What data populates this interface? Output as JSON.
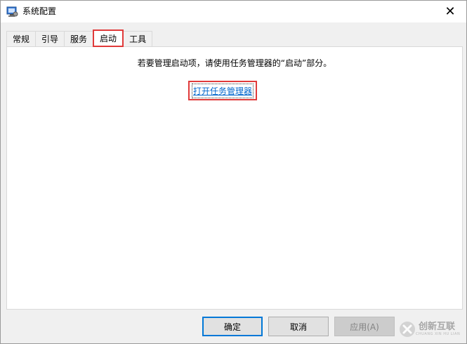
{
  "window": {
    "title": "系统配置",
    "close_glyph": "✕"
  },
  "tabs": [
    {
      "label": "常规"
    },
    {
      "label": "引导"
    },
    {
      "label": "服务"
    },
    {
      "label": "启动",
      "active": true
    },
    {
      "label": "工具"
    }
  ],
  "startup": {
    "hint": "若要管理启动项，请使用任务管理器的“启动”部分。",
    "link_label": "打开任务管理器"
  },
  "buttons": {
    "ok": "确定",
    "cancel": "取消",
    "apply": "应用(A)"
  },
  "watermark": {
    "text": "创新互联",
    "subtext": "CHUANG XIN HU LIAN"
  },
  "colors": {
    "highlight_box": "#e03a3a",
    "link": "#0066cc",
    "primary_border": "#0078d7"
  }
}
